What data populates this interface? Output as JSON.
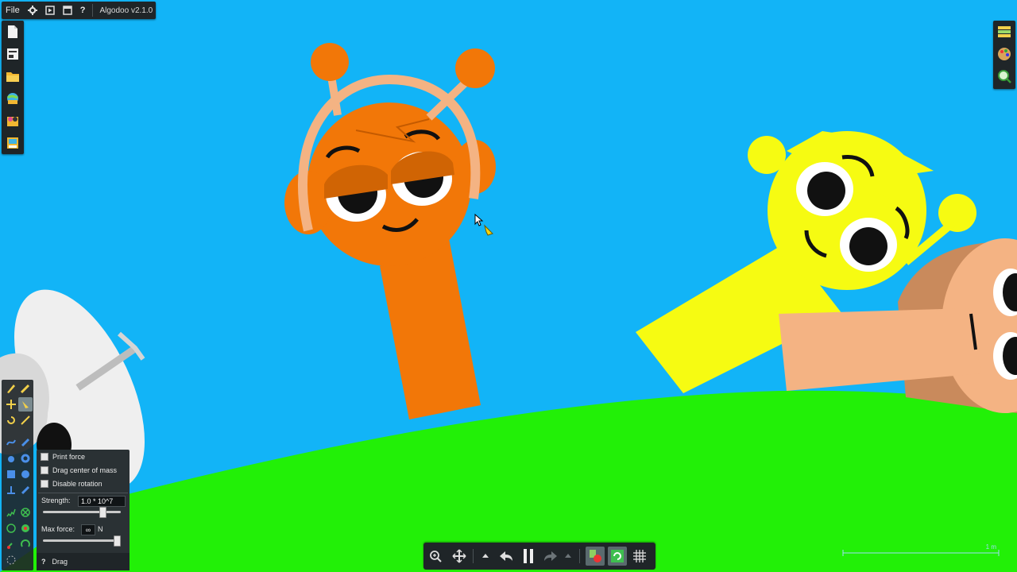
{
  "app": {
    "title": "Algodoo v2.1.0",
    "menu_file": "File"
  },
  "top_icons": [
    "gear-icon",
    "play-window-icon",
    "window-icon",
    "help-icon"
  ],
  "top_help_glyph": "?",
  "left_toolbar": [
    "new-scene-icon",
    "scene-list-icon",
    "open-folder-icon",
    "browse-online-icon",
    "phunlets-icon",
    "save-scene-icon"
  ],
  "right_toolbar": [
    "layers-icon",
    "palette-icon",
    "search-icon"
  ],
  "tool_palette": [
    "sketch-tool",
    "brush-tool",
    "move-tool",
    "drag-tool",
    "rotate-tool",
    "scale-tool",
    "rope-tool",
    "knife-tool",
    "grab-tool",
    "gear-tool",
    "box-tool",
    "circle-tool",
    "plane-tool",
    "pen-tool",
    "spring-tool",
    "fixate-tool",
    "axle-tool",
    "thruster-tool",
    "chain-tool",
    "laser-tool",
    "tracer-tool"
  ],
  "drag_options": {
    "print_force": "Print force",
    "drag_center_of_mass": "Drag center of mass",
    "disable_rotation": "Disable rotation",
    "strength_label": "Strength:",
    "strength_value": "1.0 * 10^7",
    "strength_slider": 0.8,
    "max_force_label": "Max force:",
    "max_force_value": "∞",
    "max_force_unit": "N",
    "max_force_slider": 1.0,
    "help_glyph": "?",
    "tool_name": "Drag"
  },
  "bottom_toolbar": [
    "zoom-icon",
    "pan-icon",
    "undo-arrow-up-icon",
    "undo-icon",
    "pause-icon",
    "redo-icon",
    "redo-arrow-up-icon",
    "collision-toggle-icon",
    "reset-icon",
    "grid-icon"
  ],
  "scale_label": "1 m",
  "colors": {
    "sky": "#12b4f7",
    "ground": "#22f007",
    "orange": "#f27708",
    "yellow": "#f6fb12",
    "tan": "#f4b383",
    "toolbar": "#1f2528"
  }
}
